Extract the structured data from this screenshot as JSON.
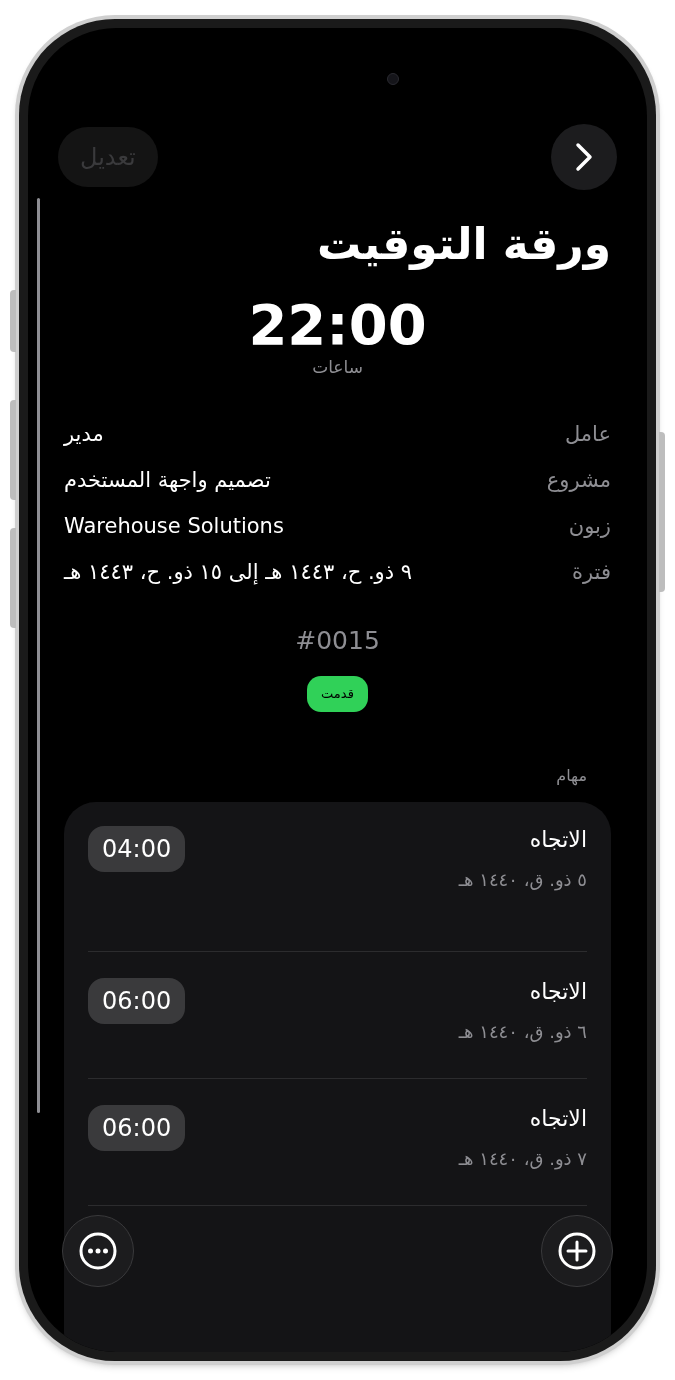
{
  "header": {
    "edit_button": {
      "label": "تعديل",
      "disabled": true
    }
  },
  "title": "ورقة التوقيت",
  "total": {
    "value": "22:00",
    "unit": "ساعات"
  },
  "details": [
    {
      "label": "عامل",
      "value": "مدير"
    },
    {
      "label": "مشروع",
      "value": "تصميم واجهة المستخدم"
    },
    {
      "label": "زبون",
      "value": "Warehouse Solutions"
    },
    {
      "label": "فترة",
      "value": "٩ ذو. ح، ١٤٤٣ هـ إلى ١٥ ذو. ح، ١٤٤٣ هـ"
    }
  ],
  "number": "#0015",
  "status": {
    "label": "قدمت",
    "color": "#30d158"
  },
  "tasks_heading": "مهام",
  "tasks": [
    {
      "title": "الاتجاه",
      "date": "٥ ذو. ق، ١٤٤٠ هـ",
      "time": "04:00"
    },
    {
      "title": "الاتجاه",
      "date": "٦ ذو. ق، ١٤٤٠ هـ",
      "time": "06:00"
    },
    {
      "title": "الاتجاه",
      "date": "٧ ذو. ق، ١٤٤٠ هـ",
      "time": "06:00"
    }
  ]
}
